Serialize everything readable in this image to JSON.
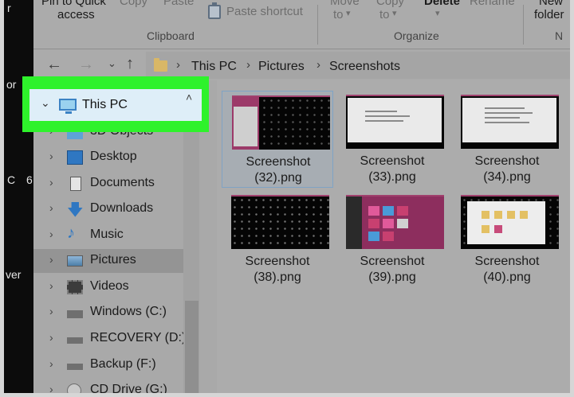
{
  "ribbon": {
    "pin_label": "Pin to Quick",
    "access_label": "access",
    "copy_label": "Copy",
    "paste_label": "Paste",
    "paste_shortcut_label": "Paste shortcut",
    "move_to_label": "Move",
    "move_to_sub": "to",
    "copy_to_label": "Copy",
    "copy_to_sub": "to",
    "delete_label": "Delete",
    "rename_label": "Rename",
    "new_folder_label": "New",
    "new_folder_sub": "folder",
    "group_clipboard": "Clipboard",
    "group_organize": "Organize",
    "group_new": "N"
  },
  "address": {
    "crumbs": [
      "This PC",
      "Pictures",
      "Screenshots"
    ]
  },
  "desktop_fragments": [
    "r",
    "or",
    "C",
    "6",
    "ver"
  ],
  "navpane": {
    "this_pc": "This PC",
    "items": [
      {
        "label": "3D Objects",
        "icon": "3d-objects-icon"
      },
      {
        "label": "Desktop",
        "icon": "desktop-folder-icon"
      },
      {
        "label": "Documents",
        "icon": "documents-icon"
      },
      {
        "label": "Downloads",
        "icon": "downloads-icon"
      },
      {
        "label": "Music",
        "icon": "music-icon"
      },
      {
        "label": "Pictures",
        "icon": "pictures-icon"
      },
      {
        "label": "Videos",
        "icon": "videos-icon"
      },
      {
        "label": "Windows (C:)",
        "icon": "windows-drive-icon"
      },
      {
        "label": "RECOVERY (D:)",
        "icon": "drive-icon"
      },
      {
        "label": "Backup (F:)",
        "icon": "drive-icon"
      },
      {
        "label": "CD Drive (G:)",
        "icon": "cd-drive-icon"
      }
    ]
  },
  "files": [
    {
      "line1": "Screenshot",
      "line2": "(32).png"
    },
    {
      "line1": "Screenshot",
      "line2": "(33).png"
    },
    {
      "line1": "Screenshot",
      "line2": "(34).png"
    },
    {
      "line1": "Screenshot",
      "line2": "(38).png"
    },
    {
      "line1": "Screenshot",
      "line2": "(39).png"
    },
    {
      "line1": "Screenshot",
      "line2": "(40).png"
    }
  ],
  "colors": {
    "highlight": "#2ef22b",
    "selection": "#deeef8"
  }
}
